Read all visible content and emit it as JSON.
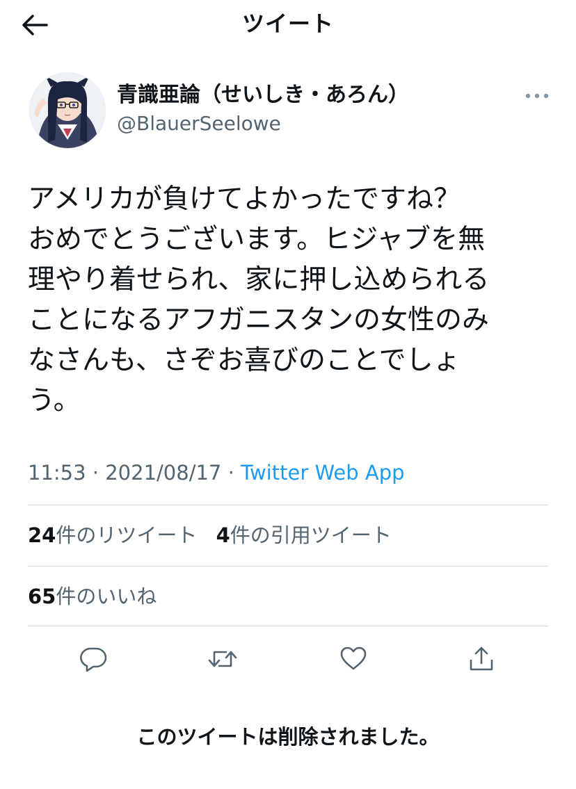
{
  "header": {
    "title": "ツイート",
    "back_icon": "arrow-left-icon"
  },
  "author": {
    "display_name": "青識亜論（せいしき・あろん）",
    "handle": "@BlauerSeelowe",
    "avatar": "anime-girl-avatar"
  },
  "tweet": {
    "lines": [
      "アメリカが負けてよかったですね？",
      "おめでとうございます。ヒジャブを無",
      "理やり着せられ、家に押し込められる",
      "ことになるアフガニスタンの女性のみ",
      "なさんも、さぞお喜びのことでしょ",
      "う。"
    ],
    "time": "11:53",
    "separator": "·",
    "date": "2021/08/17",
    "source": "Twitter Web App"
  },
  "stats": {
    "retweets_count": "24",
    "retweets_label": "件のリツイート",
    "quotes_count": "4",
    "quotes_label": "件の引用ツイート",
    "likes_count": "65",
    "likes_label": "件のいいね"
  },
  "actions": [
    "reply-icon",
    "retweet-icon",
    "like-icon",
    "share-icon"
  ],
  "deleted_notice": "このツイートは削除されました。",
  "colors": {
    "text": "#0f1419",
    "secondary": "#536471",
    "link": "#1d9bf0",
    "divider": "#cfd9de"
  }
}
